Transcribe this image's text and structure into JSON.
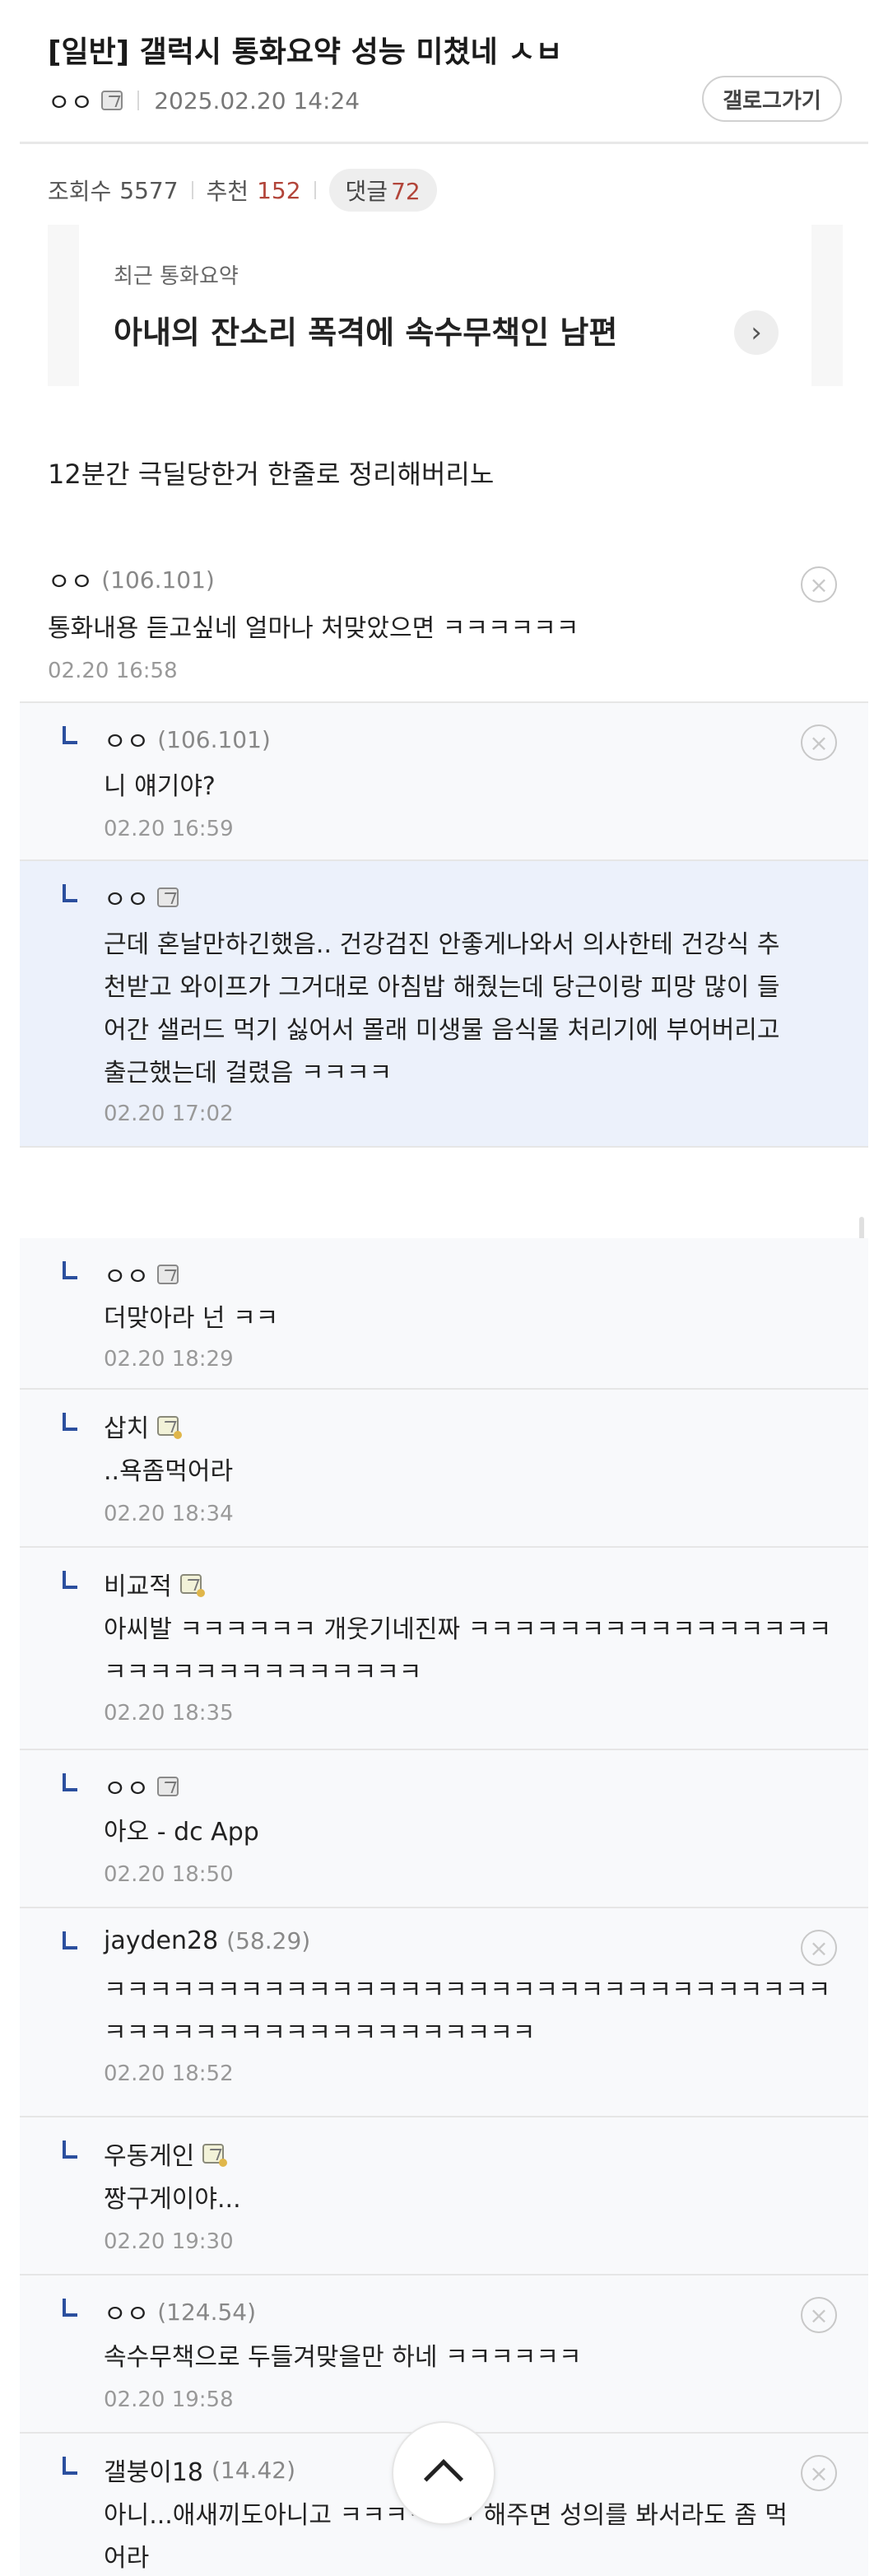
{
  "post": {
    "title": "[일반] 갤럭시 통화요약 성능 미쳤네 ㅅㅂ",
    "author": "ㅇㅇ",
    "date": "2025.02.20 14:24",
    "gallog_button": "갤로그가기"
  },
  "stats": {
    "views_label": "조회수",
    "views": "5577",
    "recommend_label": "추천",
    "recommend": "152",
    "comments_label": "댓글",
    "comments": "72"
  },
  "summary": {
    "label": "최근 통화요약",
    "text": "아내의 잔소리 폭격에 속수무책인 남편",
    "arrow": "›"
  },
  "body_text": "12분간 극딜당한거 한줄로 정리해버리노",
  "comments": [
    {
      "nick": "ㅇㅇ",
      "ip": "(106.101)",
      "text": "통화내용 듣고싶네 얼마나 처맞았으면 ㅋㅋㅋㅋㅋㅋ",
      "date": "02.20 16:58"
    },
    {
      "nick": "ㅇㅇ",
      "ip": "(106.101)",
      "text": "니 얘기야?",
      "date": "02.20 16:59"
    },
    {
      "nick": "ㅇㅇ",
      "ip": "",
      "lines": [
        "근데 혼날만하긴했음.. 건강검진 안좋게나와서 의사한테 건강식 추",
        "천받고 와이프가 그거대로 아침밥 해줬는데 당근이랑 피망 많이 들",
        "어간 샐러드 먹기 싫어서 몰래 미생물 음식물 처리기에 부어버리고",
        "출근했는데 걸렸음 ㅋㅋㅋㅋ"
      ],
      "date": "02.20 17:02"
    },
    {
      "nick": "ㅇㅇ",
      "ip": "",
      "text": "더맞아라 넌 ㅋㅋ",
      "date": "02.20 18:29"
    },
    {
      "nick": "삽치",
      "ip": "",
      "text": "..욕좀먹어라",
      "date": "02.20 18:34"
    },
    {
      "nick": "비교적",
      "ip": "",
      "lines": [
        "아씨발 ㅋㅋㅋㅋㅋㅋ 개웃기네진짜 ㅋㅋㅋㅋㅋㅋㅋㅋㅋㅋㅋㅋㅋㅋㅋㅋ",
        "ㅋㅋㅋㅋㅋㅋㅋㅋㅋㅋㅋㅋㅋㅋ"
      ],
      "date": "02.20 18:35"
    },
    {
      "nick": "ㅇㅇ",
      "ip": "",
      "text": "아오 - dc App",
      "date": "02.20 18:50"
    },
    {
      "nick": "jayden28",
      "ip": "(58.29)",
      "lines": [
        "ㅋㅋㅋㅋㅋㅋㅋㅋㅋㅋㅋㅋㅋㅋㅋㅋㅋㅋㅋㅋㅋㅋㅋㅋㅋㅋㅋㅋㅋㅋㅋㅋ",
        "ㅋㅋㅋㅋㅋㅋㅋㅋㅋㅋㅋㅋㅋㅋㅋㅋㅋㅋㅋ"
      ],
      "date": "02.20 18:52"
    },
    {
      "nick": "우동게인",
      "ip": "",
      "text": "짱구게이야...",
      "date": "02.20 19:30"
    },
    {
      "nick": "ㅇㅇ",
      "ip": "(124.54)",
      "text": "속수무책으로 두들겨맞을만 하네 ㅋㅋㅋㅋㅋㅋ",
      "date": "02.20 19:58"
    },
    {
      "nick": "갤붕이18",
      "ip": "(14.42)",
      "lines": [
        "아니...애새끼도아니고 ㅋㅋㅋㅋㅋㅋ 해주면 성의를 봐서라도 좀 먹",
        "어라"
      ],
      "date": ""
    }
  ],
  "icons": {
    "close": "×"
  }
}
